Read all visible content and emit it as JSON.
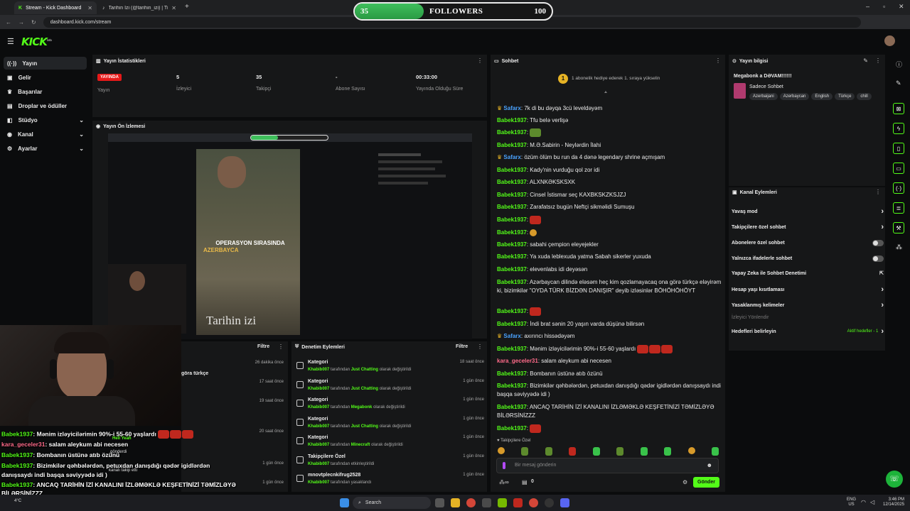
{
  "browser": {
    "tabs": [
      {
        "title": "Stream - Kick Dashboard",
        "active": true
      },
      {
        "title": "Tarihin İzi (@tarihin_izi) | TikTok",
        "active": false
      }
    ],
    "url": "dashboard.kick.com/stream"
  },
  "followers_bar": {
    "current": "35",
    "label": "FOLLOWERS",
    "goal": "100",
    "progress": 0.35
  },
  "logo": "KICK",
  "logo_sup": "beta",
  "sidebar": {
    "items": [
      {
        "label": "Yayın",
        "icon": "broadcast-icon",
        "active": true
      },
      {
        "label": "Gelir",
        "icon": "wallet-icon"
      },
      {
        "label": "Başarılar",
        "icon": "trophy-icon"
      },
      {
        "label": "Droplar ve ödüller",
        "icon": "gift-icon"
      },
      {
        "label": "Stüdyo",
        "icon": "studio-icon",
        "expand": true
      },
      {
        "label": "Kanal",
        "icon": "user-icon",
        "expand": true
      },
      {
        "label": "Ayarlar",
        "icon": "gear-icon",
        "expand": true
      }
    ]
  },
  "stats": {
    "title": "Yayın İstatistikleri",
    "live_badge": "YAYINDA",
    "live_label": "Yayın",
    "viewers": "5",
    "viewers_label": "İzleyici",
    "followers": "35",
    "followers_label": "Takipçi",
    "subs": "-",
    "subs_label": "Abone Sayısı",
    "uptime": "00:33:00",
    "uptime_label": "Yayında Olduğu Süre"
  },
  "preview": {
    "title": "Yayın Ön İzlemesi",
    "video_caption": "OPERASYON SIRASINDA",
    "video_caption2": "AZERBAYCA",
    "watermark": "Tarihin izi"
  },
  "activity": {
    "filter": "Filtre",
    "partial": "göra türkçe",
    "times": [
      "26 dakika önce",
      "17 saat önce",
      "19 saat önce",
      "20 saat önce",
      "1 gün önce",
      "1 gün önce"
    ]
  },
  "moderation": {
    "title": "Denetim Eylemleri",
    "filter": "Filtre",
    "rows": [
      {
        "title": "Kategori",
        "user": "Khabib007",
        "mid": "tarafından",
        "value": "Just Chatting",
        "end": "olarak değiştirildi",
        "time": "18 saat önce"
      },
      {
        "title": "Kategori",
        "user": "Khabib007",
        "mid": "tarafından",
        "value": "Just Chatting",
        "end": "olarak değiştirildi",
        "time": "1 gün önce"
      },
      {
        "title": "Kategori",
        "user": "Khabib007",
        "mid": "tarafından",
        "value": "Megabonk",
        "end": "olarak değiştirildi",
        "time": "1 gün önce"
      },
      {
        "title": "Kategori",
        "user": "Khabib007",
        "mid": "tarafından",
        "value": "Just Chatting",
        "end": "olarak değiştirildi",
        "time": "1 gün önce"
      },
      {
        "title": "Kategori",
        "user": "Khabib007",
        "mid": "tarafından",
        "value": "Minecraft",
        "end": "olarak değiştirildi",
        "time": "1 gün önce"
      },
      {
        "title": "Takipçilere Özel",
        "user": "Khabib007",
        "mid": "tarafından etkinleştirildi",
        "value": "",
        "end": "",
        "time": "1 gün önce"
      },
      {
        "title": "mnovtplecnkifrug2528",
        "user": "Khabib007",
        "mid": "tarafından yasaklandı",
        "value": "",
        "end": "",
        "time": "1 gün önce"
      }
    ]
  },
  "chat": {
    "title": "Sohbet",
    "gift_banner": "1 abonelik hediye ederek 1. sıraya yükselin",
    "messages": [
      {
        "user": "Safarx",
        "text": ": 7k di bu dəyqa 3cü leveldəyəm",
        "cls": "u3"
      },
      {
        "user": "Babek1937",
        "text": ": Tfu belə verlişə",
        "cls": "u"
      },
      {
        "user": "Babek1937",
        "text": ":",
        "cls": "u",
        "emote": "g"
      },
      {
        "user": "Babek1937",
        "text": ": M.Ə.Sabirin - Neylərdin İlahi",
        "cls": "u"
      },
      {
        "user": "Safarx",
        "text": ": özüm ölüm bu run da 4 dənə legendary shrine açmışam",
        "cls": "u3"
      },
      {
        "user": "Babek1937",
        "text": ": Kady'nin vurduğu qol zor idi",
        "cls": "u"
      },
      {
        "user": "Babek1937",
        "text": ": ALXNKƏKSKSXK",
        "cls": "u"
      },
      {
        "user": "Babek1937",
        "text": ": Cinsel İstismar seç KAXBKSKZKSJZJ",
        "cls": "u"
      },
      {
        "user": "Babek1937",
        "text": ": Zarafatsız bugün Neftçi sikməlidi Sumuşu",
        "cls": "u"
      },
      {
        "user": "Babek1937",
        "text": ":",
        "cls": "u",
        "emote": "r"
      },
      {
        "user": "Babek1937",
        "text": ":",
        "cls": "u",
        "emote": "o"
      },
      {
        "user": "Babek1937",
        "text": ": sabahi çempion eleyejekler",
        "cls": "u"
      },
      {
        "user": "Babek1937",
        "text": ": Ya xuda leblexuda yatma Sabah sikerler yuxuda",
        "cls": "u"
      },
      {
        "user": "Babek1937",
        "text": ": elevenlabs idi deyəsən",
        "cls": "u"
      },
      {
        "user": "Babek1937",
        "text": ": Azərbaycan dilində eləsəm heç kim qozlamayacaq ona görə türkçə eləyirəm ki, bizimkilər \"OYDA TÜRK BİZDƏN DANIŞIR\" deyib izləsinlər BÖHÖHÖHÖYT",
        "cls": "u"
      },
      {
        "user": "Babek1937",
        "text": ":",
        "cls": "u",
        "emote": "r"
      },
      {
        "user": "Babek1937",
        "text": ": İndi brat sənin 20 yaşın varda düşünə bilirsən",
        "cls": "u"
      },
      {
        "user": "Safarx",
        "text": ": axırıncı hissədəyəm",
        "cls": "u3"
      },
      {
        "user": "Babek1937",
        "text": ": Mənim izləyicilərimin 90%-i 55-60 yaşlardı",
        "cls": "u",
        "emote": "rrr"
      },
      {
        "user": "kara_geceler31",
        "text": ": salam aleykum abi necesen",
        "cls": "u2"
      },
      {
        "user": "Babek1937",
        "text": ": Bombanın üstünə atıb özünü",
        "cls": "u"
      },
      {
        "user": "Babek1937",
        "text": ": Bizimkilər qəhbələrdən, petuxdan danışdığı qədər igidlərdən danışsaydı indi başqa səviyyədə idi )",
        "cls": "u"
      },
      {
        "user": "Babek1937",
        "text": ": ANCAQ TARİHİN İZİ KANALINI İZLƏMƏKLƏ KEŞFETİNİZİ TƏMİZLƏYƏ BİLƏRSİNİZZZ",
        "cls": "u"
      },
      {
        "user": "Babek1937",
        "text": ":",
        "cls": "u",
        "emote": "r"
      }
    ],
    "followers_only": "Takipçilere Özel",
    "placeholder": "Bir mesaj gönderin",
    "send": "Gönder",
    "points": "0"
  },
  "stream_info": {
    "title": "Yayın bilgisi",
    "stream_title": "Megabonk a DƏVAM!!!!!!",
    "category": "Sadece Sohbet",
    "tags": [
      "Azerbaijani",
      "Azerbaycan",
      "English",
      "Türkçe",
      "chill"
    ]
  },
  "channel_actions": {
    "title": "Kanal Eylemleri",
    "items": [
      {
        "label": "Yavaş mod",
        "type": "arrow"
      },
      {
        "label": "Takipçilere özel sohbet",
        "type": "arrow"
      },
      {
        "label": "Abonelere özel sohbet",
        "type": "toggle"
      },
      {
        "label": "Yalnızca ifadelerle sohbet",
        "type": "toggle"
      },
      {
        "label": "Yapay Zeka ile Sohbet Denetimi",
        "type": "ext"
      },
      {
        "label": "Hesap yaşı kısıtlaması",
        "type": "arrow"
      },
      {
        "label": "Yasaklanmış kelimeler",
        "type": "arrow"
      }
    ],
    "muted_label": "İzleyici Yönlendir",
    "goals_label": "Hedefleri belirleyin",
    "goals_status": "Aktif hedefler - 1"
  },
  "overlay_chat": [
    {
      "user": "Babek1937",
      "text": ": Mənim izləyicilərimin 90%-i 55-60 yaşlardı",
      "cls": "u"
    },
    {
      "user": "kara_geceler31",
      "text": ": salam aleykum abi necesen",
      "cls": "u2"
    },
    {
      "user": "Babek1937",
      "text": ": Bombanın üstünə atıb özünü",
      "cls": "u"
    },
    {
      "user": "Babek1937",
      "text": ": Bizimkilər qəhbələrdən, petuxdan danışdığı qədər igidlərdən",
      "cls": "u"
    },
    {
      "user": "",
      "text": "danışsaydı indi başqa səviyyədə idi )",
      "cls": "u"
    },
    {
      "user": "Babek1937",
      "text": ": ANCAQ TARİHİN İZİ KANALINI İZLƏMƏKLƏ KEŞFETİNİZİ TƏMİZLƏYƏ",
      "cls": "u"
    },
    {
      "user": "",
      "text": "BİLƏRSİNİZZZ",
      "cls": "u"
    },
    {
      "user": "Babek1937",
      "text": ":",
      "cls": "u"
    }
  ],
  "overlay_alerts": [
    "Heil Yeah",
    "gönderdi",
    "kanalı takip etti"
  ],
  "taskbar": {
    "search": "Search",
    "lang": "ENG",
    "region": "US",
    "time": "3:46 PM",
    "date": "12/14/2025",
    "temp": "4°C"
  },
  "colors": {
    "accent": "#53fc18",
    "live": "#e61919",
    "panel": "#161718",
    "bg": "#0b0c0d"
  }
}
